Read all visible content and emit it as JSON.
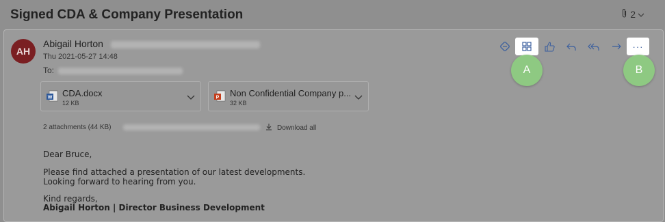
{
  "subject": "Signed CDA & Company Presentation",
  "attachment_count": "2",
  "sender": {
    "initials": "AH",
    "name": "Abigail Horton",
    "date": "Thu 2021-05-27 14:48",
    "to_label": "To:"
  },
  "toolbar": {
    "icons": [
      "immersive-reader-icon",
      "apps-grid-icon",
      "like-icon",
      "reply-icon",
      "reply-all-icon",
      "forward-icon",
      "more-actions-icon"
    ],
    "more_label": "···"
  },
  "callouts": {
    "a": "A",
    "b": "B"
  },
  "attachments": [
    {
      "name": "CDA.docx",
      "size": "12 KB",
      "icon": "word-file-icon"
    },
    {
      "name": "Non Confidential Company p...",
      "size": "32 KB",
      "icon": "powerpoint-file-icon"
    }
  ],
  "attachments_summary": "2 attachments (44 KB)",
  "download_all": "Download all",
  "body": {
    "greeting": "Dear Bruce,",
    "line1": "Please find attached a presentation of our latest developments.",
    "line2": "Looking forward to hearing from you.",
    "closing": "Kind regards,",
    "signature": "Abigail Horton | Director Business Development"
  },
  "colors": {
    "avatar": "#7a1f22",
    "callout": "#8ec982",
    "accent_icon": "#3b5f9e"
  }
}
